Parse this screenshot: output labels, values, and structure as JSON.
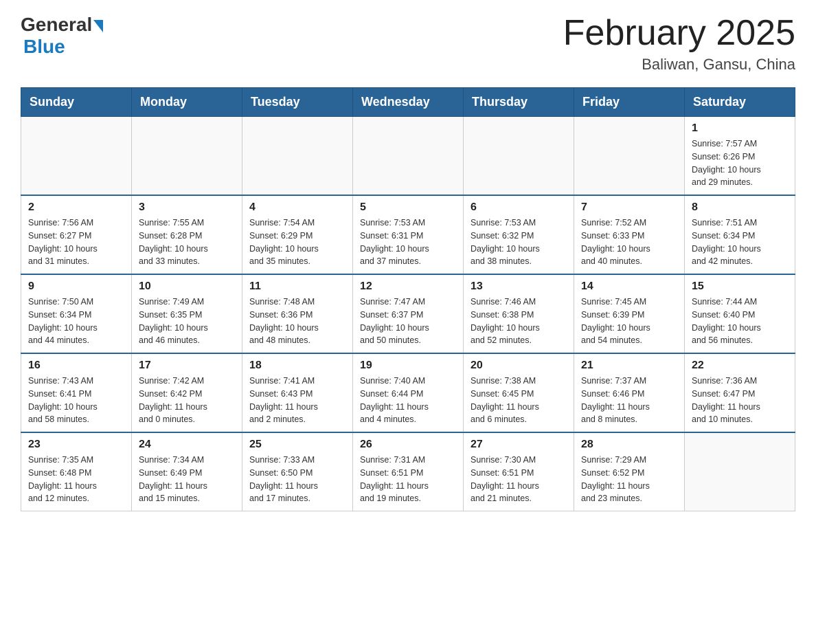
{
  "header": {
    "logo": {
      "general": "General",
      "blue": "Blue"
    },
    "title": "February 2025",
    "location": "Baliwan, Gansu, China"
  },
  "days_of_week": [
    "Sunday",
    "Monday",
    "Tuesday",
    "Wednesday",
    "Thursday",
    "Friday",
    "Saturday"
  ],
  "weeks": [
    [
      {
        "day": "",
        "info": ""
      },
      {
        "day": "",
        "info": ""
      },
      {
        "day": "",
        "info": ""
      },
      {
        "day": "",
        "info": ""
      },
      {
        "day": "",
        "info": ""
      },
      {
        "day": "",
        "info": ""
      },
      {
        "day": "1",
        "info": "Sunrise: 7:57 AM\nSunset: 6:26 PM\nDaylight: 10 hours\nand 29 minutes."
      }
    ],
    [
      {
        "day": "2",
        "info": "Sunrise: 7:56 AM\nSunset: 6:27 PM\nDaylight: 10 hours\nand 31 minutes."
      },
      {
        "day": "3",
        "info": "Sunrise: 7:55 AM\nSunset: 6:28 PM\nDaylight: 10 hours\nand 33 minutes."
      },
      {
        "day": "4",
        "info": "Sunrise: 7:54 AM\nSunset: 6:29 PM\nDaylight: 10 hours\nand 35 minutes."
      },
      {
        "day": "5",
        "info": "Sunrise: 7:53 AM\nSunset: 6:31 PM\nDaylight: 10 hours\nand 37 minutes."
      },
      {
        "day": "6",
        "info": "Sunrise: 7:53 AM\nSunset: 6:32 PM\nDaylight: 10 hours\nand 38 minutes."
      },
      {
        "day": "7",
        "info": "Sunrise: 7:52 AM\nSunset: 6:33 PM\nDaylight: 10 hours\nand 40 minutes."
      },
      {
        "day": "8",
        "info": "Sunrise: 7:51 AM\nSunset: 6:34 PM\nDaylight: 10 hours\nand 42 minutes."
      }
    ],
    [
      {
        "day": "9",
        "info": "Sunrise: 7:50 AM\nSunset: 6:34 PM\nDaylight: 10 hours\nand 44 minutes."
      },
      {
        "day": "10",
        "info": "Sunrise: 7:49 AM\nSunset: 6:35 PM\nDaylight: 10 hours\nand 46 minutes."
      },
      {
        "day": "11",
        "info": "Sunrise: 7:48 AM\nSunset: 6:36 PM\nDaylight: 10 hours\nand 48 minutes."
      },
      {
        "day": "12",
        "info": "Sunrise: 7:47 AM\nSunset: 6:37 PM\nDaylight: 10 hours\nand 50 minutes."
      },
      {
        "day": "13",
        "info": "Sunrise: 7:46 AM\nSunset: 6:38 PM\nDaylight: 10 hours\nand 52 minutes."
      },
      {
        "day": "14",
        "info": "Sunrise: 7:45 AM\nSunset: 6:39 PM\nDaylight: 10 hours\nand 54 minutes."
      },
      {
        "day": "15",
        "info": "Sunrise: 7:44 AM\nSunset: 6:40 PM\nDaylight: 10 hours\nand 56 minutes."
      }
    ],
    [
      {
        "day": "16",
        "info": "Sunrise: 7:43 AM\nSunset: 6:41 PM\nDaylight: 10 hours\nand 58 minutes."
      },
      {
        "day": "17",
        "info": "Sunrise: 7:42 AM\nSunset: 6:42 PM\nDaylight: 11 hours\nand 0 minutes."
      },
      {
        "day": "18",
        "info": "Sunrise: 7:41 AM\nSunset: 6:43 PM\nDaylight: 11 hours\nand 2 minutes."
      },
      {
        "day": "19",
        "info": "Sunrise: 7:40 AM\nSunset: 6:44 PM\nDaylight: 11 hours\nand 4 minutes."
      },
      {
        "day": "20",
        "info": "Sunrise: 7:38 AM\nSunset: 6:45 PM\nDaylight: 11 hours\nand 6 minutes."
      },
      {
        "day": "21",
        "info": "Sunrise: 7:37 AM\nSunset: 6:46 PM\nDaylight: 11 hours\nand 8 minutes."
      },
      {
        "day": "22",
        "info": "Sunrise: 7:36 AM\nSunset: 6:47 PM\nDaylight: 11 hours\nand 10 minutes."
      }
    ],
    [
      {
        "day": "23",
        "info": "Sunrise: 7:35 AM\nSunset: 6:48 PM\nDaylight: 11 hours\nand 12 minutes."
      },
      {
        "day": "24",
        "info": "Sunrise: 7:34 AM\nSunset: 6:49 PM\nDaylight: 11 hours\nand 15 minutes."
      },
      {
        "day": "25",
        "info": "Sunrise: 7:33 AM\nSunset: 6:50 PM\nDaylight: 11 hours\nand 17 minutes."
      },
      {
        "day": "26",
        "info": "Sunrise: 7:31 AM\nSunset: 6:51 PM\nDaylight: 11 hours\nand 19 minutes."
      },
      {
        "day": "27",
        "info": "Sunrise: 7:30 AM\nSunset: 6:51 PM\nDaylight: 11 hours\nand 21 minutes."
      },
      {
        "day": "28",
        "info": "Sunrise: 7:29 AM\nSunset: 6:52 PM\nDaylight: 11 hours\nand 23 minutes."
      },
      {
        "day": "",
        "info": ""
      }
    ]
  ]
}
